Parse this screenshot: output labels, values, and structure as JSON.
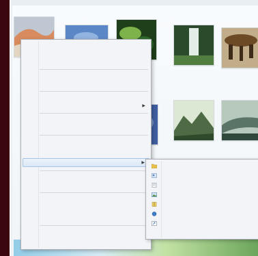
{
  "thumbnails": [
    {
      "name": "thumb-landscape",
      "label": "",
      "colors": [
        "#d78b5e",
        "#e2d6c2",
        "#bfc8d2"
      ]
    },
    {
      "name": "thumb-sky",
      "label": "",
      "colors": [
        "#5c87c6",
        "#91b3e0",
        "#2e5c9a"
      ]
    },
    {
      "name": "thumb-leaves",
      "label": "",
      "colors": [
        "#2e6a2b",
        "#7eb24b",
        "#1f3f1b"
      ]
    },
    {
      "name": "thumb-waterfall",
      "label": "",
      "colors": [
        "#2b4a2c",
        "#e4ece8",
        "#517d41"
      ]
    },
    {
      "name": "thumb-rocks",
      "label": "",
      "colors": [
        "#6c4a26",
        "#c2ad8a",
        "#3d2b18"
      ]
    },
    {
      "name": "thumb-sky-2",
      "label": "",
      "colors": [
        "#7790c7",
        "#c9d3ea",
        "#3f5fa0"
      ]
    },
    {
      "name": "thumb-mountain",
      "label": "",
      "colors": [
        "#4e6b45",
        "#dce7d4",
        "#2f4a2a"
      ]
    },
    {
      "name": "thumb-reptile",
      "label": "",
      "colors": [
        "#5a7468",
        "#b7c8bc",
        "#31483d"
      ]
    }
  ],
  "context_menu": {
    "items": [
      "",
      "",
      "",
      "",
      "",
      "",
      "",
      "",
      "",
      "",
      "",
      "",
      "",
      "",
      "",
      "",
      "",
      ""
    ]
  },
  "submenu": {
    "items": [
      {
        "icon": "folder-icon",
        "label": ""
      },
      {
        "icon": "contact-icon",
        "label": ""
      },
      {
        "icon": "document-icon",
        "label": ""
      },
      {
        "icon": "image-icon",
        "label": ""
      },
      {
        "icon": "archive-icon",
        "label": ""
      },
      {
        "icon": "app-icon",
        "label": ""
      },
      {
        "icon": "shortcut-icon",
        "label": ""
      }
    ]
  }
}
